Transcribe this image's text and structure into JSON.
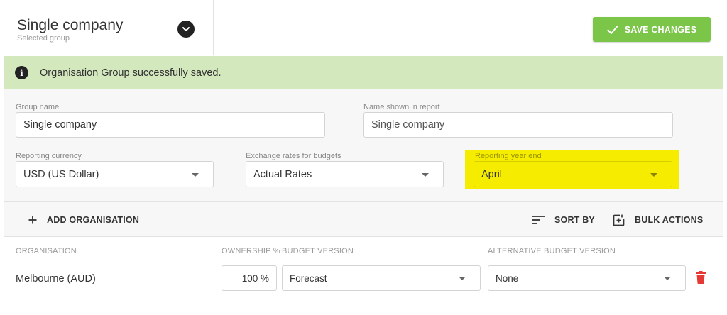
{
  "header": {
    "group_title": "Single company",
    "group_subtitle": "Selected group",
    "save_label": "SAVE CHANGES"
  },
  "alert": {
    "message": "Organisation Group successfully saved."
  },
  "form": {
    "group_name": {
      "label": "Group name",
      "value": "Single company"
    },
    "name_in_report": {
      "label": "Name shown in report",
      "value": "Single company"
    },
    "reporting_currency": {
      "label": "Reporting currency",
      "value": "USD (US Dollar)"
    },
    "exchange_rates": {
      "label": "Exchange rates for budgets",
      "value": "Actual Rates"
    },
    "reporting_year_end": {
      "label": "Reporting year end",
      "value": "April"
    }
  },
  "toolbar": {
    "add_label": "ADD ORGANISATION",
    "sort_label": "SORT BY",
    "bulk_label": "BULK ACTIONS"
  },
  "table": {
    "headers": {
      "organisation": "ORGANISATION",
      "ownership": "OWNERSHIP %",
      "budget_version": "BUDGET VERSION",
      "alt_budget_version": "ALTERNATIVE BUDGET VERSION"
    },
    "rows": [
      {
        "organisation": "Melbourne (AUD)",
        "ownership": "100 %",
        "budget_version": "Forecast",
        "alt_budget_version": "None"
      }
    ]
  },
  "colors": {
    "save_green": "#7bc548",
    "alert_bg": "#d4e8bd",
    "highlight": "#f5ec00",
    "delete_red": "#e53935"
  }
}
